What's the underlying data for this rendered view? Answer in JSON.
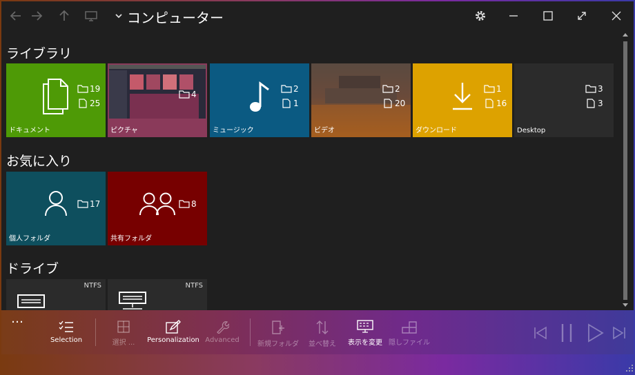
{
  "window": {
    "title": "コンピューター"
  },
  "sections": {
    "libraries": "ライブラリ",
    "favorites": "お気に入り",
    "drives": "ドライブ"
  },
  "libraries": [
    {
      "label": "ドキュメント",
      "folders": "19",
      "files": "25",
      "color": "#4e9a06",
      "icon": "document-icon"
    },
    {
      "label": "ピクチャ",
      "folders": "4",
      "files": "",
      "color": "#8a3a5a",
      "icon": "picture-thumbnail"
    },
    {
      "label": "ミュージック",
      "folders": "2",
      "files": "1",
      "color": "#0b5a82",
      "icon": "music-note-icon"
    },
    {
      "label": "ビデオ",
      "folders": "2",
      "files": "20",
      "color": "#6a4a35",
      "icon": "video-thumbnail"
    },
    {
      "label": "ダウンロード",
      "folders": "1",
      "files": "16",
      "color": "#dda200",
      "icon": "download-icon"
    },
    {
      "label": "Desktop",
      "folders": "3",
      "files": "3",
      "color": "#2b2b2b",
      "icon": ""
    }
  ],
  "favorites": [
    {
      "label": "個人フォルダ",
      "folders": "17",
      "color": "#0e4f5e",
      "icon": "person-icon"
    },
    {
      "label": "共有フォルダ",
      "folders": "8",
      "color": "#770000",
      "icon": "people-icon"
    }
  ],
  "drives": [
    {
      "fs": "NTFS",
      "icon": "drive-icon"
    },
    {
      "fs": "NTFS",
      "icon": "network-drive-icon"
    }
  ],
  "commandbar": {
    "more": "…",
    "selection": "Selection",
    "select_all": "選択 ...",
    "personalization": "Personalization",
    "advanced": "Advanced",
    "new_folder": "新規フォルダ",
    "sort": "並べ替え",
    "change_view": "表示を変更",
    "hidden_files": "隠しファイル"
  }
}
